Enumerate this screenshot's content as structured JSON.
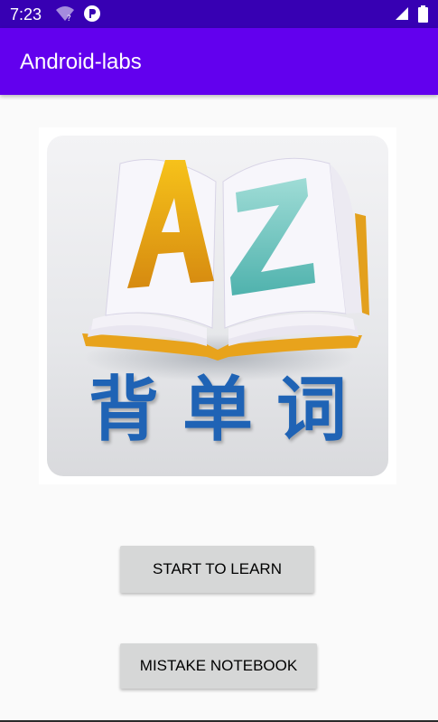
{
  "status_bar": {
    "time": "7:23",
    "icons": [
      "wifi-question-icon",
      "notification-p-icon",
      "cell-signal-icon",
      "battery-icon"
    ],
    "color": "#3700b3"
  },
  "app_bar": {
    "title": "Android-labs",
    "color": "#6200ee"
  },
  "logo": {
    "letters": [
      "A",
      "Z"
    ],
    "caption": "背单词"
  },
  "buttons": {
    "start_label": "START TO LEARN",
    "mistake_label": "MISTAKE NOTEBOOK",
    "color": "#d6d7d7"
  }
}
